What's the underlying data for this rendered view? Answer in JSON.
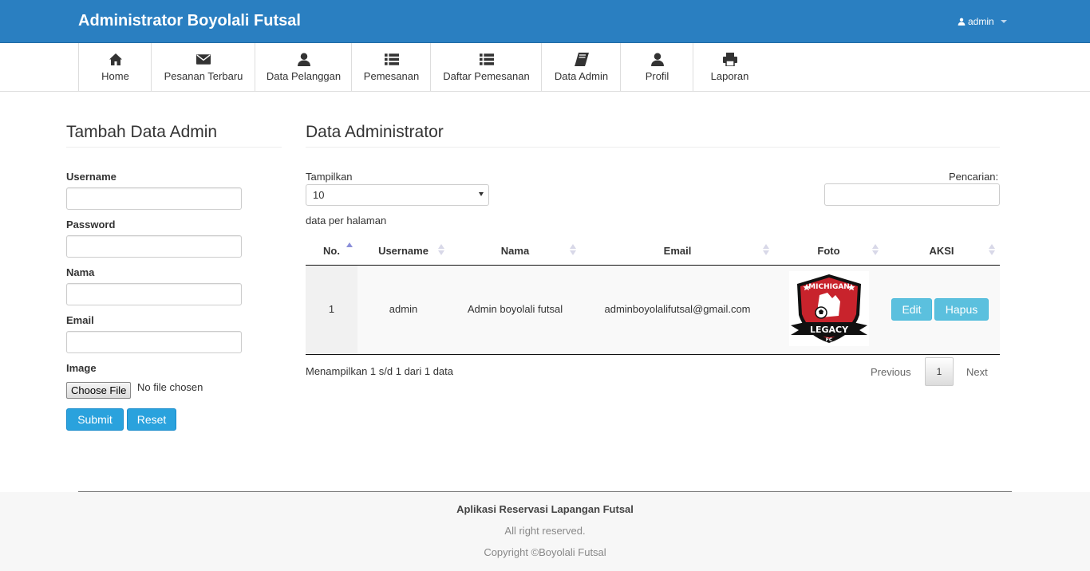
{
  "brand": "Administrator Boyolali Futsal",
  "user": {
    "name": "admin"
  },
  "nav": [
    {
      "label": "Home",
      "icon": "home-icon"
    },
    {
      "label": "Pesanan Terbaru",
      "icon": "envelope-icon"
    },
    {
      "label": "Data Pelanggan",
      "icon": "user-icon"
    },
    {
      "label": "Pemesanan",
      "icon": "list-icon"
    },
    {
      "label": "Daftar Pemesanan",
      "icon": "list-icon"
    },
    {
      "label": "Data Admin",
      "icon": "book-icon"
    },
    {
      "label": "Profil",
      "icon": "user-icon"
    },
    {
      "label": "Laporan",
      "icon": "print-icon"
    }
  ],
  "form": {
    "title": "Tambah Data Admin",
    "username_label": "Username",
    "password_label": "Password",
    "nama_label": "Nama",
    "email_label": "Email",
    "image_label": "Image",
    "file_button": "Choose File",
    "file_status": "No file chosen",
    "submit": "Submit",
    "reset": "Reset"
  },
  "table": {
    "title": "Data Administrator",
    "show_label": "Tampilkan",
    "page_size": "10",
    "per_page_label": "data per halaman",
    "search_label": "Pencarian:",
    "columns": [
      "No.",
      "Username",
      "Nama",
      "Email",
      "Foto",
      "AKSI"
    ],
    "rows": [
      {
        "no": "1",
        "username": "admin",
        "nama": "Admin boyolali futsal",
        "email": "adminboyolalifutsal@gmail.com",
        "edit": "Edit",
        "hapus": "Hapus"
      }
    ],
    "logo_text_top": "MICHIGAN",
    "logo_text_main": "LEGACY",
    "logo_text_bottom": "FC",
    "info": "Menampilkan 1 s/d 1 dari 1 data",
    "prev": "Previous",
    "current_page": "1",
    "next": "Next"
  },
  "footer": {
    "title": "Aplikasi Reservasi Lapangan Futsal",
    "rights": "All right reserved.",
    "copyright": "Copyright ©Boyolali Futsal"
  },
  "colors": {
    "header": "#2a7fc1",
    "primary_button": "#2aa2dd",
    "info_button": "#5bc0de"
  }
}
